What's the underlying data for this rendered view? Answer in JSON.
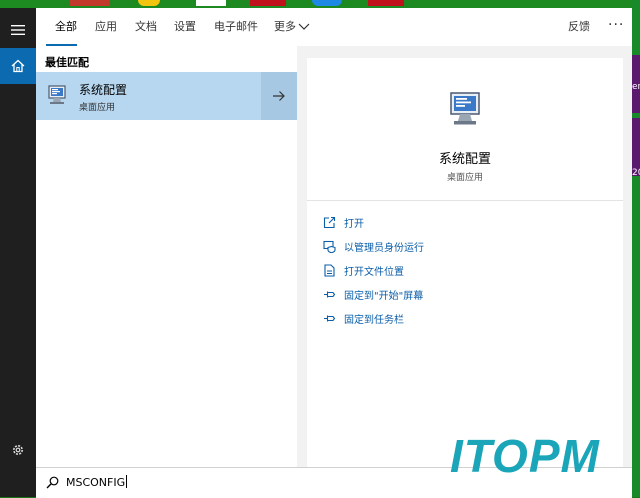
{
  "tabs": [
    {
      "label": "全部",
      "active": true
    },
    {
      "label": "应用"
    },
    {
      "label": "文档"
    },
    {
      "label": "设置"
    },
    {
      "label": "电子邮件"
    },
    {
      "label": "更多"
    }
  ],
  "header": {
    "feedback_label": "反馈",
    "more_dots": "···"
  },
  "left_pane": {
    "section_title": "最佳匹配",
    "best_match": {
      "title": "系统配置",
      "subtitle": "桌面应用",
      "icon": "system-config-icon"
    }
  },
  "right_pane": {
    "title": "系统配置",
    "subtitle": "桌面应用",
    "actions": [
      {
        "label": "打开",
        "icon": "open-icon"
      },
      {
        "label": "以管理员身份运行",
        "icon": "shield-admin-icon"
      },
      {
        "label": "打开文件位置",
        "icon": "file-location-icon"
      },
      {
        "label": "固定到\"开始\"屏幕",
        "icon": "pin-icon"
      },
      {
        "label": "固定到任务栏",
        "icon": "pin-icon"
      }
    ]
  },
  "search": {
    "value": "MSCONFIG"
  },
  "desktop_partial_text": [
    "er",
    "20"
  ],
  "watermark": "ITOPM",
  "colors": {
    "accent": "#0b6ab0",
    "selection": "#b7d7f0",
    "rail": "#1f1f1f",
    "link": "#0b5ea8"
  }
}
